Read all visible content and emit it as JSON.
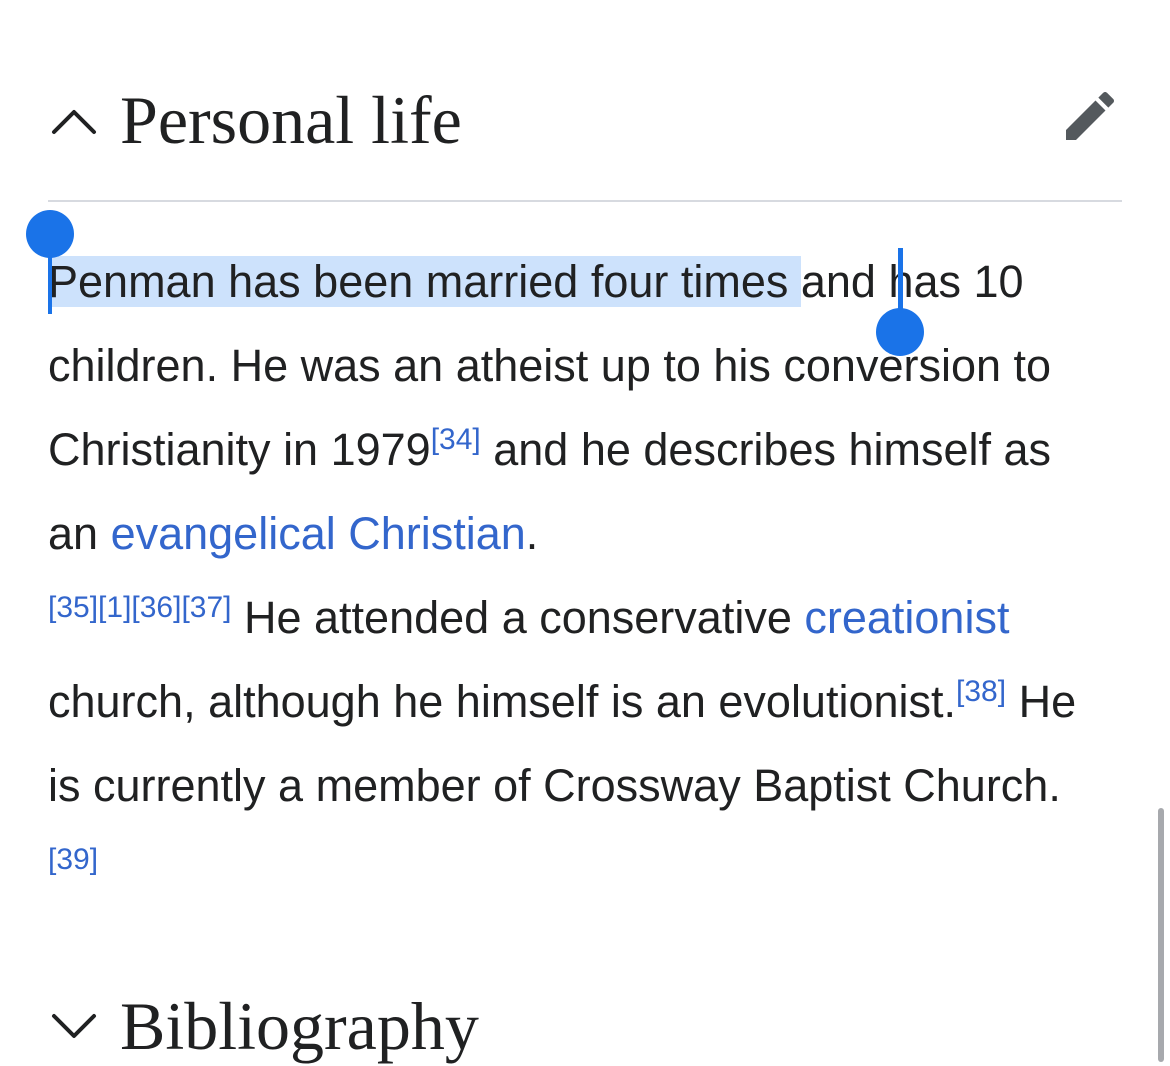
{
  "sections": {
    "personal_life": {
      "title": "Personal life",
      "expanded": true
    },
    "bibliography": {
      "title": "Bibliography",
      "expanded": false
    }
  },
  "paragraph": {
    "selected_text": "Penman has been married four times ",
    "t1": "and has 10 children. He was an atheist up to his conversion to Christianity in 1979",
    "ref34": "[34]",
    "t2": " and he describes himself as an ",
    "link_evangelical": "evangelical Christian",
    "t3": ".",
    "ref35": "[35]",
    "ref1": "[1]",
    "ref36": "[36]",
    "ref37": "[37]",
    "t4": " He attended a conservative ",
    "link_creationist": "creationist",
    "t5": " church, although he himself is an evolutionist.",
    "ref38": "[38]",
    "t6": " He is currently a member of Crossway Baptist Church.",
    "ref39": "[39]"
  },
  "colors": {
    "text": "#202122",
    "link": "#3366cc",
    "selection": "#cde2fc",
    "handle": "#1a73e8",
    "divider": "#d7dae0"
  },
  "icons": {
    "collapse": "chevron-up-icon",
    "expand": "chevron-down-icon",
    "edit": "pencil-icon"
  }
}
